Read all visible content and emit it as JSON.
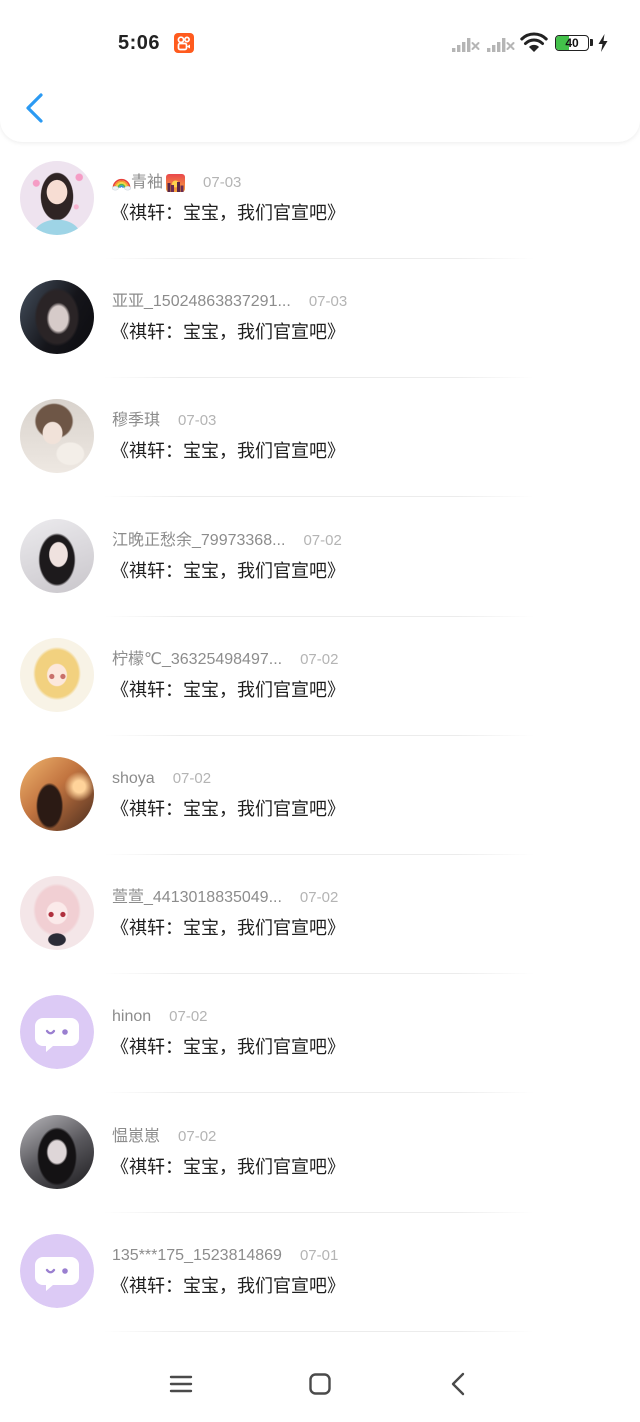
{
  "status_bar": {
    "time": "5:06",
    "app_icon": "kuaishou-app-icon",
    "signal_icons": [
      "no-service-signal-icon",
      "no-service-signal-icon"
    ],
    "wifi_icon": "wifi-icon",
    "battery_level": "40",
    "charging_icon": "charging-bolt-icon"
  },
  "header": {
    "back_icon": "back-chevron-icon"
  },
  "items": [
    {
      "name": "青袖",
      "name_prefix_icon": "rainbow-emoji-icon",
      "name_suffix_icon": "sunset-city-emoji-icon",
      "date": "07-03",
      "title": "《祺轩：宝宝，我们官宣吧》",
      "avatar_icon": "user-photo-avatar"
    },
    {
      "name": "亚亚_15024863837291...",
      "date": "07-03",
      "title": "《祺轩：宝宝，我们官宣吧》",
      "avatar_icon": "user-photo-avatar"
    },
    {
      "name": "穆季琪",
      "date": "07-03",
      "title": "《祺轩：宝宝，我们官宣吧》",
      "avatar_icon": "user-photo-avatar"
    },
    {
      "name": "江晚正愁余_79973368...",
      "date": "07-02",
      "title": "《祺轩：宝宝，我们官宣吧》",
      "avatar_icon": "user-photo-avatar"
    },
    {
      "name": "柠檬℃_36325498497...",
      "date": "07-02",
      "title": "《祺轩：宝宝，我们官宣吧》",
      "avatar_icon": "user-photo-avatar"
    },
    {
      "name": "shoya",
      "date": "07-02",
      "title": "《祺轩：宝宝，我们官宣吧》",
      "avatar_icon": "user-photo-avatar"
    },
    {
      "name": "萱萱_4413018835049...",
      "date": "07-02",
      "title": "《祺轩：宝宝，我们官宣吧》",
      "avatar_icon": "user-photo-avatar"
    },
    {
      "name": "hinon",
      "date": "07-02",
      "title": "《祺轩：宝宝，我们官宣吧》",
      "avatar_icon": "default-chat-bubble-avatar-icon"
    },
    {
      "name": "愠崽崽",
      "date": "07-02",
      "title": "《祺轩：宝宝，我们官宣吧》",
      "avatar_icon": "user-photo-avatar"
    },
    {
      "name": "135***175_1523814869",
      "date": "07-01",
      "title": "《祺轩：宝宝，我们官宣吧》",
      "avatar_icon": "default-chat-bubble-avatar-icon"
    }
  ],
  "nav_bar": {
    "menu_icon": "menu-icon",
    "home_icon": "home-square-icon",
    "back_icon": "back-arrow-icon"
  },
  "colors": {
    "accent": "#2b9af3",
    "name_text": "#8c8c8c",
    "date_text": "#b4b4b4",
    "title_text": "#1e1e1e",
    "default_avatar": "#dccaf5",
    "battery_fill": "#43c14a",
    "app_icon": "#ff5b1e"
  }
}
